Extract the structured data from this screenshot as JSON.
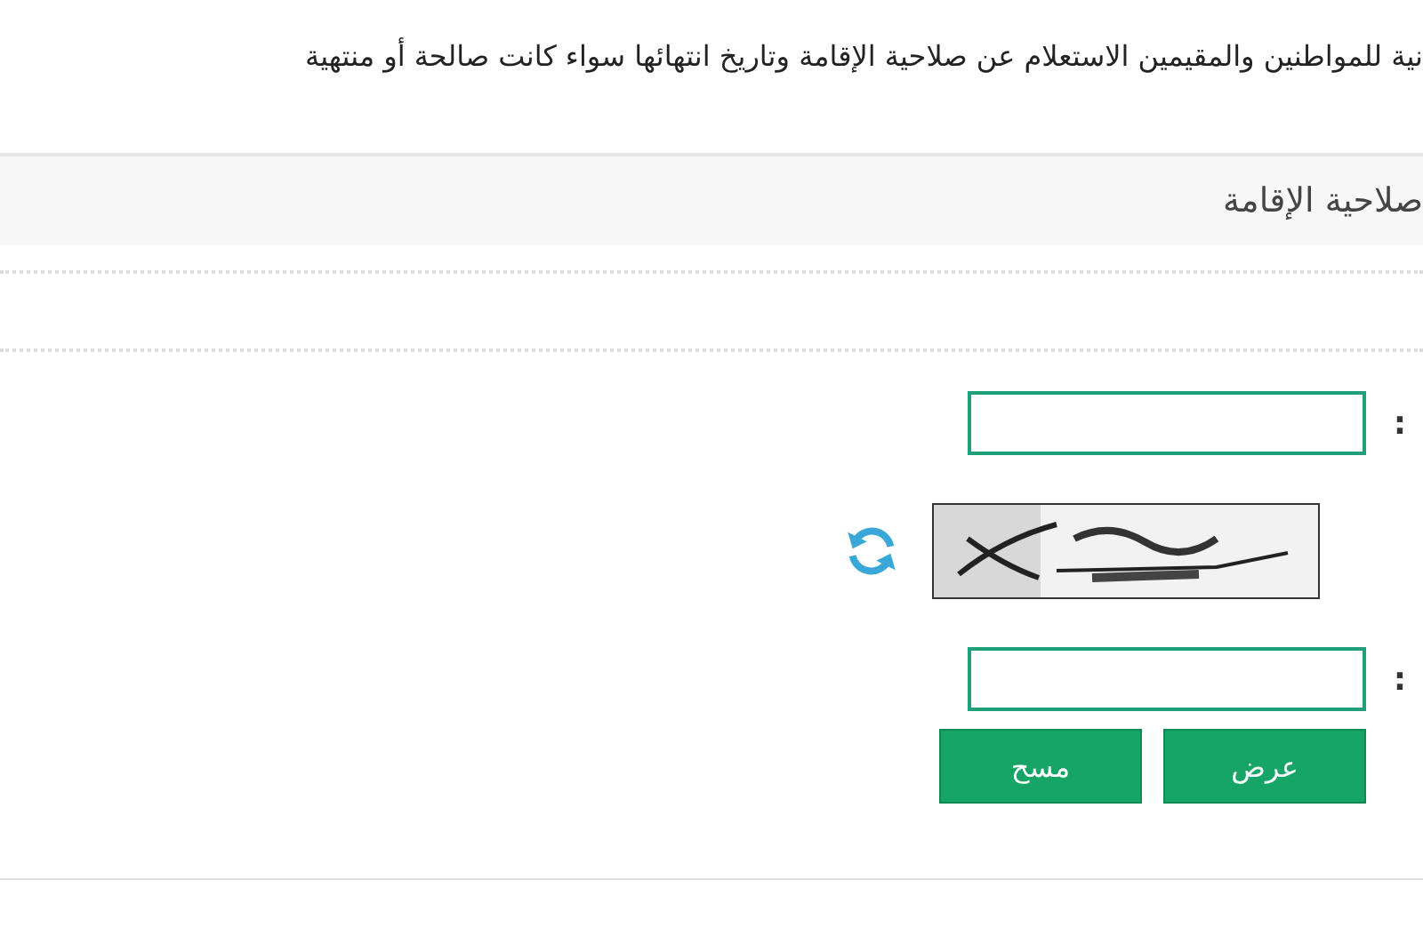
{
  "intro": "نية للمواطنين والمقيمين الاستعلام عن صلاحية الإقامة وتاريخ انتهائها سواء كانت صالحة أو منتهية",
  "section": {
    "title": "صلاحية الإقامة"
  },
  "form": {
    "fields": [
      {
        "kind": "input",
        "label": ":"
      },
      {
        "kind": "captcha"
      },
      {
        "kind": "input",
        "label": ":"
      }
    ],
    "buttons": [
      {
        "label": "عرض"
      },
      {
        "label": "مسح"
      }
    ]
  }
}
